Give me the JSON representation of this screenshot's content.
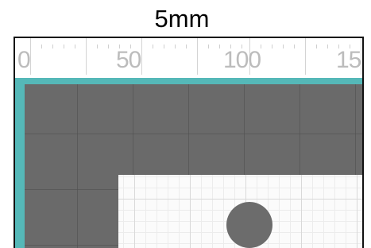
{
  "caption": "5mm",
  "ruler": {
    "labels": [
      "0",
      "50",
      "100",
      "15"
    ]
  },
  "colors": {
    "workspace": "#6a6a6a",
    "board": "#fbfbfb",
    "accent": "#55b8b8",
    "hole": "#6c6c6c"
  },
  "icons": {
    "hole": "circle-hole-icon"
  }
}
